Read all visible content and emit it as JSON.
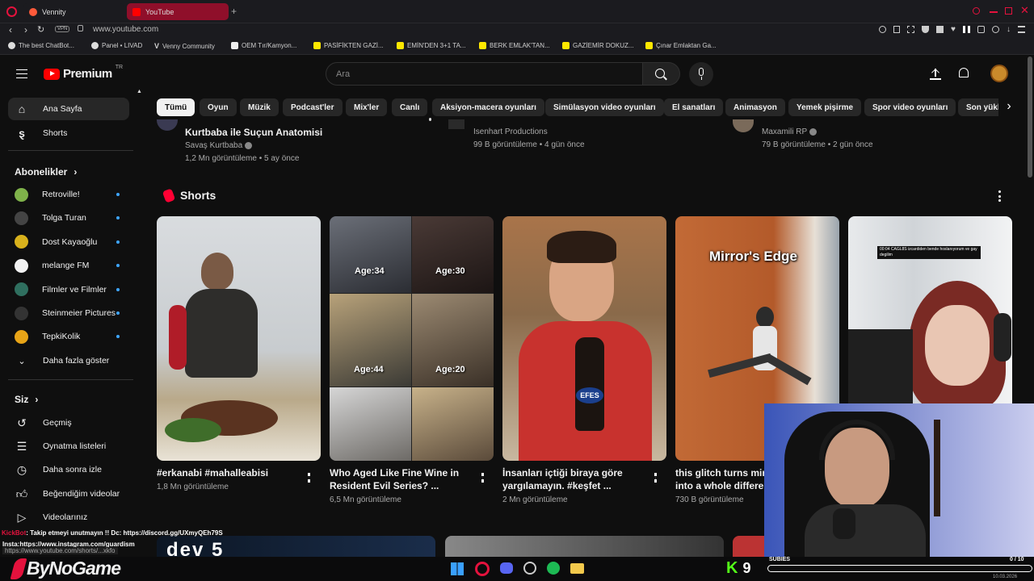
{
  "browser": {
    "tabs": [
      {
        "label": "Vennity"
      },
      {
        "label": "YouTube"
      }
    ],
    "address": "www.youtube.com",
    "vpn_label": "VPN",
    "bookmarks": [
      {
        "label": "The best ChatBot..."
      },
      {
        "label": "Panel • LIVAD"
      },
      {
        "label": "Venny Community"
      },
      {
        "label": "OEM Tır/Kamyon..."
      },
      {
        "label": "PASİFİKTEN GAZİ..."
      },
      {
        "label": "EMİN'DEN 3+1 TA..."
      },
      {
        "label": "BERK EMLAK'TAN..."
      },
      {
        "label": "GAZİEMİR DOKUZ..."
      },
      {
        "label": "Çınar Emlaktan Ga..."
      }
    ]
  },
  "header": {
    "logo_text": "Premium",
    "logo_region": "TR",
    "search_placeholder": "Ara"
  },
  "sidebar": {
    "main": [
      {
        "label": "Ana Sayfa"
      },
      {
        "label": "Shorts"
      }
    ],
    "subs_title": "Abonelikler",
    "subs": [
      {
        "label": "Retroville!",
        "color": "#7fb24a"
      },
      {
        "label": "Tolga Turan",
        "color": "#444444"
      },
      {
        "label": "Dost Kayaoğlu",
        "color": "#d8b11c"
      },
      {
        "label": "melange FM",
        "color": "#f2f2f2"
      },
      {
        "label": "Filmler ve Filmler",
        "color": "#2f6f5f"
      },
      {
        "label": "Steinmeier Pictures",
        "color": "#333333"
      },
      {
        "label": "TepkiKolik",
        "color": "#e8a417"
      }
    ],
    "show_more": "Daha fazla göster",
    "you_title": "Siz",
    "you": [
      {
        "label": "Geçmiş"
      },
      {
        "label": "Oynatma listeleri"
      },
      {
        "label": "Daha sonra izle"
      },
      {
        "label": "Beğendiğim videolar"
      },
      {
        "label": "Videolarınız"
      }
    ]
  },
  "chips": [
    "Tümü",
    "Oyun",
    "Müzik",
    "Podcast'ler",
    "Mix'ler",
    "Canlı",
    "Aksiyon-macera oyunları",
    "Simülasyon video oyunları",
    "El sanatları",
    "Animasyon",
    "Yemek pişirme",
    "Spor video oyunları",
    "Son yükle"
  ],
  "top_videos": [
    {
      "title": "Kurtbaba ile Suçun Anatomisi",
      "channel": "Savaş Kurtbaba",
      "views": "1,2 Mn görüntüleme",
      "age": "5 ay önce"
    },
    {
      "title": "",
      "channel": "Isenhart Productions",
      "views": "99 B görüntüleme",
      "age": "4 gün önce"
    },
    {
      "title": "",
      "channel": "Maxamili RP",
      "views": "79 B görüntüleme",
      "age": "2 gün önce"
    }
  ],
  "shorts": {
    "title": "Shorts",
    "items": [
      {
        "title": "#erkanabi #mahalleabisi",
        "title2": "",
        "views": "1,8 Mn görüntüleme"
      },
      {
        "title": "Who Aged Like Fine Wine in",
        "title2": "Resident Evil Series? ...",
        "views": "6,5 Mn görüntüleme",
        "ages": [
          "Age:34",
          "Age:30",
          "Age:44",
          "Age:20"
        ]
      },
      {
        "title": "İnsanları içtiği biraya göre",
        "title2": "yargılamayın. #keşfet ...",
        "views": "2 Mn görüntüleme",
        "badge": "EFES"
      },
      {
        "title": "this glitch turns mirro",
        "title2": "into a whole different",
        "views": "730 B görüntüleme",
        "overlay": "Mirror's Edge"
      },
      {
        "overlay_chat": "CAGL8S izcardiden bende hoslanıyorum ve gay degilim",
        "chat_time": "00:04"
      }
    ]
  },
  "stream": {
    "chat_line_user": "KickBot",
    "chat_line_text": ": Takip etmeyi unutmayın !! Dc: https://discord.gg/UXmyQEh79S",
    "insta_text": "Insta:https://www.instagram.com/guardism",
    "url_hover": "https://www.youtube.com/shorts/...xkfo",
    "brand": "ByNoGame",
    "subs_label": "SUBIES",
    "subs_count": "0 / 10",
    "kick_num": "9",
    "date": "10.03.2026"
  }
}
